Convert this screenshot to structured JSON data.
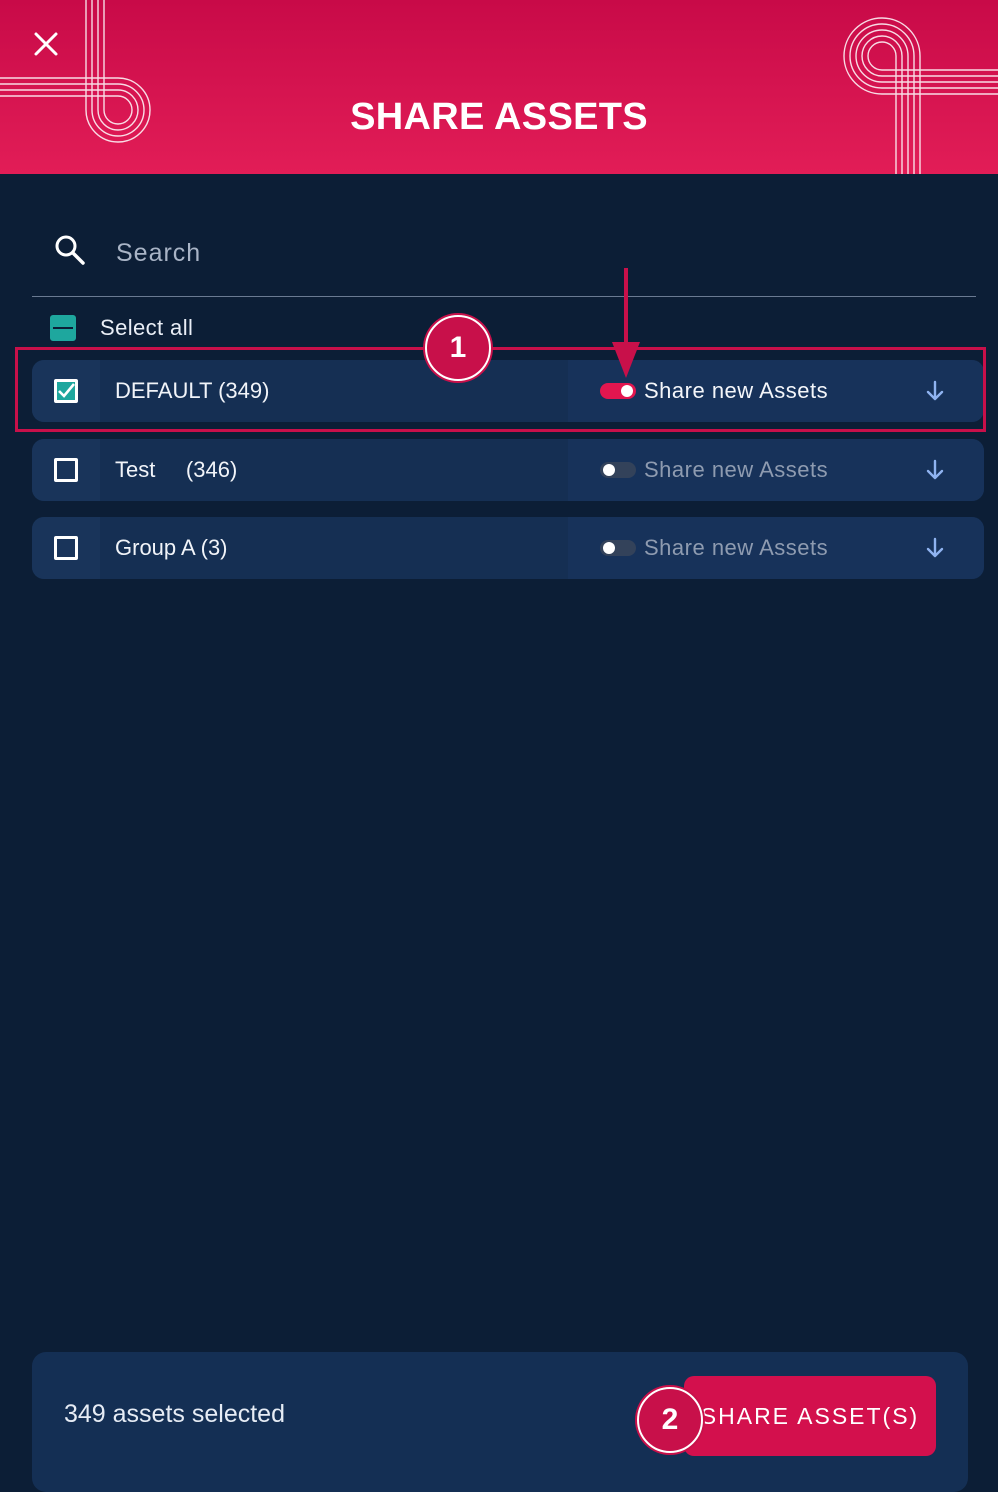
{
  "header": {
    "title": "SHARE ASSETS",
    "close_icon": "close-icon",
    "background_color": "#d1104d"
  },
  "search": {
    "placeholder": "Search",
    "value": "",
    "icon": "search-icon"
  },
  "select_all": {
    "label": "Select all",
    "state": "indeterminate"
  },
  "groups": [
    {
      "name": "DEFAULT (349)",
      "checked": true,
      "share_new_label": "Share new Assets",
      "share_new_enabled": true
    },
    {
      "name": "Test     (346)",
      "checked": false,
      "share_new_label": "Share new Assets",
      "share_new_enabled": false
    },
    {
      "name": "Group A (3)",
      "checked": false,
      "share_new_label": "Share new Assets",
      "share_new_enabled": false
    }
  ],
  "annotations": {
    "step_1": "1",
    "step_2": "2",
    "accent_color": "#c8104a"
  },
  "footer": {
    "selected_text": "349 assets selected",
    "share_button_label": "SHARE ASSET(S)"
  },
  "colors": {
    "background": "#0c1e36",
    "row": "#152f53",
    "checkbox_checked": "#1ea79e",
    "toggle_on": "#e2164f"
  }
}
